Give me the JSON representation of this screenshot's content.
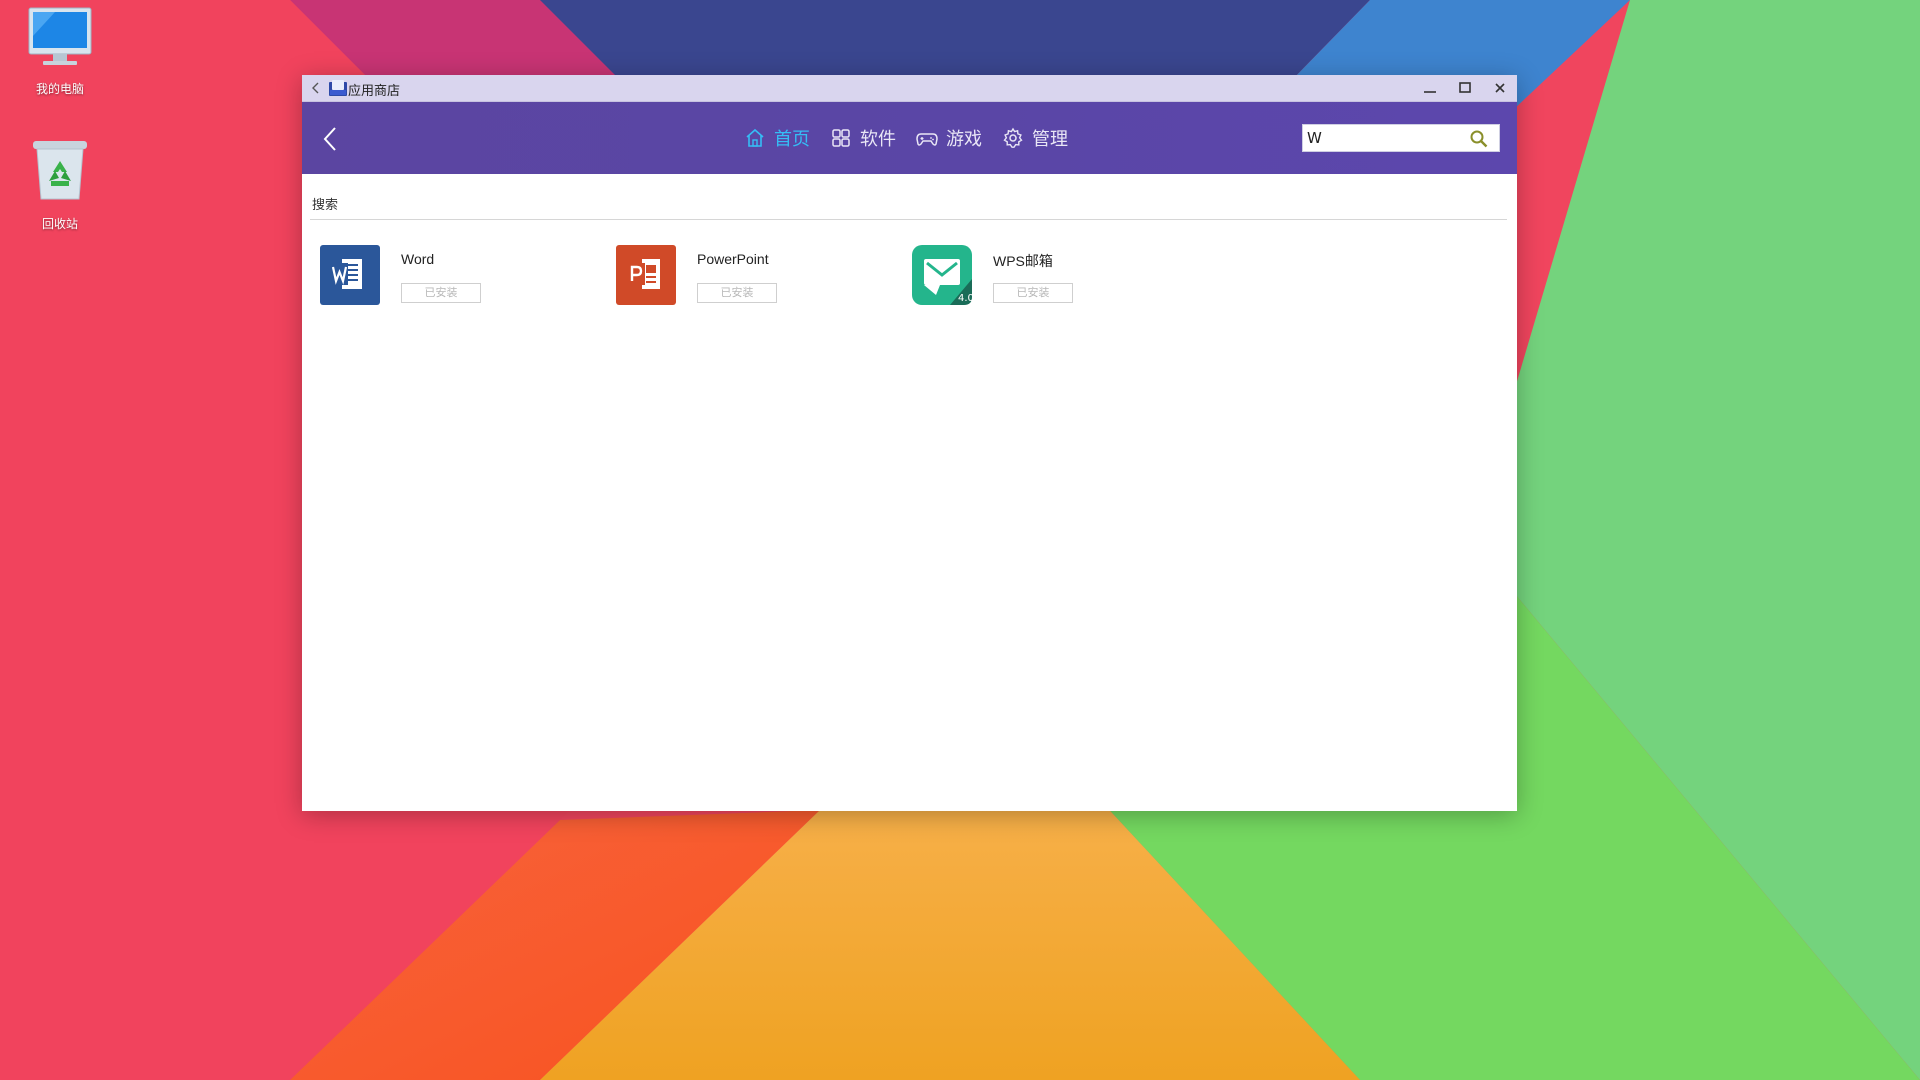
{
  "desktop": {
    "icons": [
      {
        "label": "我的电脑",
        "icon": "computer-icon"
      },
      {
        "label": "回收站",
        "icon": "recycle-bin-icon"
      }
    ]
  },
  "window": {
    "title": "应用商店",
    "app_icon": "app-store-icon"
  },
  "header": {
    "nav": [
      {
        "label": "首页",
        "icon": "home-icon",
        "active": true
      },
      {
        "label": "软件",
        "icon": "grid-icon",
        "active": false
      },
      {
        "label": "游戏",
        "icon": "gamepad-icon",
        "active": false
      },
      {
        "label": "管理",
        "icon": "gear-icon",
        "active": false
      }
    ],
    "search": {
      "value": "W",
      "icon": "search-icon"
    }
  },
  "content": {
    "section_title": "搜索",
    "apps": [
      {
        "name": "Word",
        "button": "已安装",
        "icon": "word-icon",
        "color": "#2b579a"
      },
      {
        "name": "PowerPoint",
        "button": "已安装",
        "icon": "powerpoint-icon",
        "color": "#d04a28"
      },
      {
        "name": "WPS邮箱",
        "button": "已安装",
        "icon": "wps-mail-icon",
        "color": "#24b58c"
      }
    ]
  },
  "colors": {
    "header": "#5b46a6",
    "titlebar": "#d9d5ee",
    "nav_active": "#35bdf5"
  }
}
